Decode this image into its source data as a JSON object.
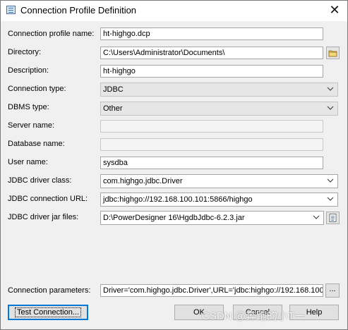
{
  "window": {
    "title": "Connection Profile Definition",
    "close_glyph": "✕"
  },
  "form": {
    "profile_name": {
      "label": "Connection profile name:",
      "value": "ht-highgo.dcp"
    },
    "directory": {
      "label": "Directory:",
      "value": "C:\\Users\\Administrator\\Documents\\",
      "browse_icon": "folder-icon"
    },
    "description": {
      "label": "Description:",
      "value": "ht-highgo"
    },
    "connection_type": {
      "label": "Connection type:",
      "value": "JDBC"
    },
    "dbms_type": {
      "label": "DBMS type:",
      "value": "Other"
    },
    "server_name": {
      "label": "Server name:",
      "value": ""
    },
    "database_name": {
      "label": "Database name:",
      "value": ""
    },
    "user_name": {
      "label": "User name:",
      "value": "sysdba"
    },
    "jdbc_driver_class": {
      "label": "JDBC driver class:",
      "value": "com.highgo.jdbc.Driver"
    },
    "jdbc_connection_url": {
      "label": "JDBC connection URL:",
      "value": "jdbc:highgo://192.168.100.101:5866/highgo"
    },
    "jdbc_driver_jar": {
      "label": "JDBC driver jar files:",
      "value": "D:\\PowerDesigner 16\\HgdbJdbc-6.2.3.jar",
      "browse_icon": "notepad-icon"
    },
    "connection_parameters": {
      "label": "Connection parameters:",
      "value": "Driver='com.highgo.jdbc.Driver',URL='jdbc:highgo://192.168.100.",
      "more_label": "..."
    }
  },
  "buttons": {
    "test_connection": "Test Connection...",
    "ok": "OK",
    "cancel": "Cancel",
    "help": "Help"
  },
  "watermark": "CSDN @奔跑的小T一"
}
